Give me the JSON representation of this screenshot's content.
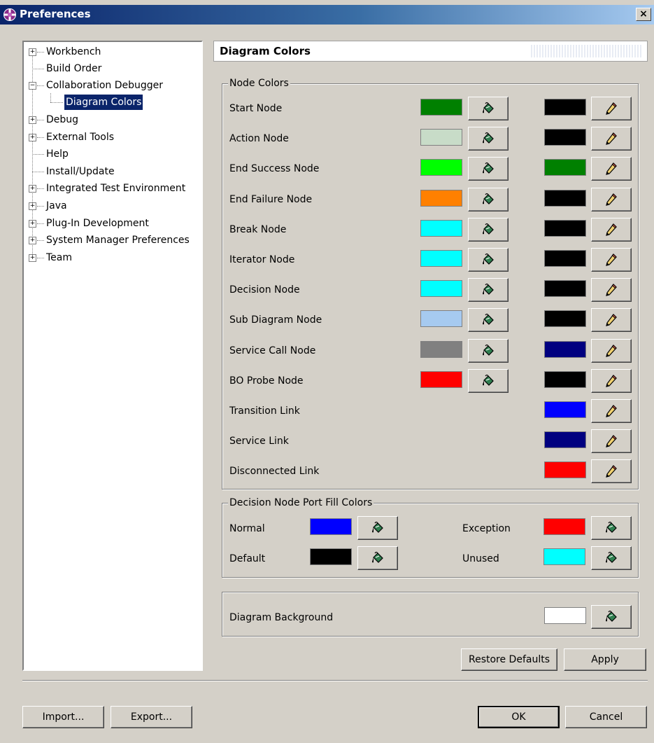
{
  "window": {
    "title": "Preferences",
    "close_glyph": "×"
  },
  "tree": {
    "items": [
      {
        "label": "Workbench",
        "expander": "+"
      },
      {
        "label": "Build Order",
        "expander": ""
      },
      {
        "label": "Collaboration Debugger",
        "expander": "−"
      },
      {
        "label": "Diagram Colors",
        "expander": "",
        "selected": true
      },
      {
        "label": "Debug",
        "expander": "+"
      },
      {
        "label": "External Tools",
        "expander": "+"
      },
      {
        "label": "Help",
        "expander": ""
      },
      {
        "label": "Install/Update",
        "expander": ""
      },
      {
        "label": "Integrated Test Environment",
        "expander": "+"
      },
      {
        "label": "Java",
        "expander": "+"
      },
      {
        "label": "Plug-In Development",
        "expander": "+"
      },
      {
        "label": "System Manager Preferences",
        "expander": "+"
      },
      {
        "label": "Team",
        "expander": "+"
      }
    ]
  },
  "page": {
    "title": "Diagram Colors"
  },
  "node_colors": {
    "title": "Node Colors",
    "rows": [
      {
        "label": "Start Node",
        "fill": "#008000",
        "line": "#000000",
        "icons": [
          "fill-color-icon",
          "pencil-icon"
        ]
      },
      {
        "label": "Action Node",
        "fill": "#c8dcc8",
        "line": "#000000",
        "icons": [
          "fill-color-icon",
          "pencil-icon"
        ]
      },
      {
        "label": "End Success Node",
        "fill": "#00ff00",
        "line": "#008000",
        "icons": [
          "fill-color-icon",
          "pencil-icon"
        ]
      },
      {
        "label": "End Failure Node",
        "fill": "#ff8000",
        "line": "#000000",
        "icons": [
          "fill-color-icon",
          "pencil-icon"
        ]
      },
      {
        "label": "Break Node",
        "fill": "#00ffff",
        "line": "#000000",
        "icons": [
          "fill-color-icon",
          "pencil-icon"
        ]
      },
      {
        "label": "Iterator Node",
        "fill": "#00ffff",
        "line": "#000000",
        "icons": [
          "fill-color-icon",
          "pencil-icon"
        ]
      },
      {
        "label": "Decision Node",
        "fill": "#00ffff",
        "line": "#000000",
        "icons": [
          "fill-color-icon",
          "pencil-icon"
        ]
      },
      {
        "label": "Sub Diagram Node",
        "fill": "#a6caf0",
        "line": "#000000",
        "icons": [
          "fill-color-icon",
          "pencil-icon"
        ]
      },
      {
        "label": "Service Call Node",
        "fill": "#808080",
        "line": "#000080",
        "icons": [
          "fill-color-icon",
          "pencil-icon"
        ]
      },
      {
        "label": "BO Probe Node",
        "fill": "#ff0000",
        "line": "#000000",
        "icons": [
          "fill-color-icon",
          "pencil-icon"
        ]
      },
      {
        "label": "Transition Link",
        "fill": null,
        "line": "#0000ff",
        "icons": [
          "pencil-icon"
        ]
      },
      {
        "label": "Service Link",
        "fill": null,
        "line": "#000080",
        "icons": [
          "pencil-icon"
        ]
      },
      {
        "label": "Disconnected Link",
        "fill": null,
        "line": "#ff0000",
        "icons": [
          "pencil-icon"
        ]
      }
    ]
  },
  "port_fill": {
    "title": "Decision Node Port Fill Colors",
    "items": [
      {
        "label": "Normal",
        "color": "#0000ff"
      },
      {
        "label": "Exception",
        "color": "#ff0000"
      },
      {
        "label": "Default",
        "color": "#000000"
      },
      {
        "label": "Unused",
        "color": "#00ffff"
      }
    ]
  },
  "background": {
    "label": "Diagram Background",
    "color": "#ffffff"
  },
  "buttons": {
    "restore_defaults": "Restore Defaults",
    "apply": "Apply",
    "import": "Import...",
    "export": "Export...",
    "ok": "OK",
    "cancel": "Cancel"
  }
}
